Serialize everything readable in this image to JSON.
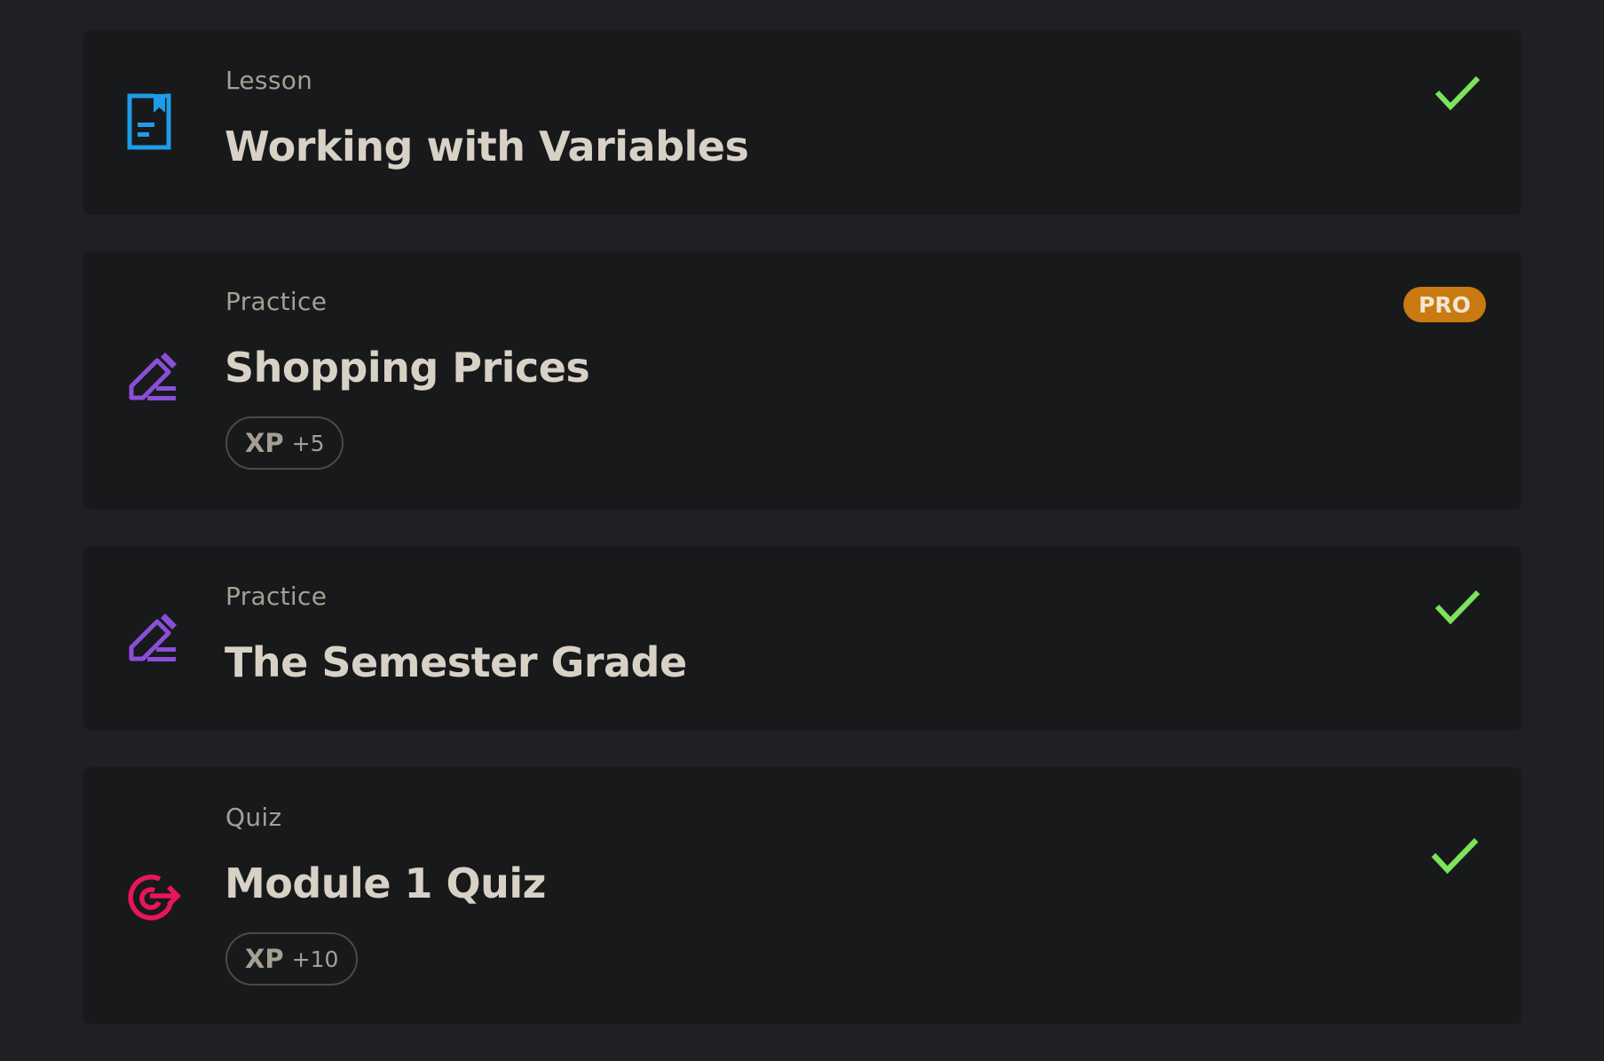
{
  "items": [
    {
      "type": "Lesson",
      "title": "Working with Variables",
      "icon": "lesson-document-icon",
      "status": "completed"
    },
    {
      "type": "Practice",
      "title": "Shopping Prices",
      "icon": "practice-pencil-icon",
      "badge": "PRO",
      "xp_label": "XP",
      "xp_value": "+5"
    },
    {
      "type": "Practice",
      "title": "The Semester Grade",
      "icon": "practice-pencil-icon",
      "status": "completed"
    },
    {
      "type": "Quiz",
      "title": "Module 1 Quiz",
      "icon": "quiz-target-icon",
      "status": "completed",
      "xp_label": "XP",
      "xp_value": "+10"
    }
  ],
  "colors": {
    "page_background": "#1f2023",
    "card_background": "#18191b",
    "lesson_icon": "#1e9be9",
    "practice_icon": "#8a4fd8",
    "quiz_icon": "#e81659",
    "check": "#7ce35a",
    "pro_badge": "#c97a10"
  }
}
